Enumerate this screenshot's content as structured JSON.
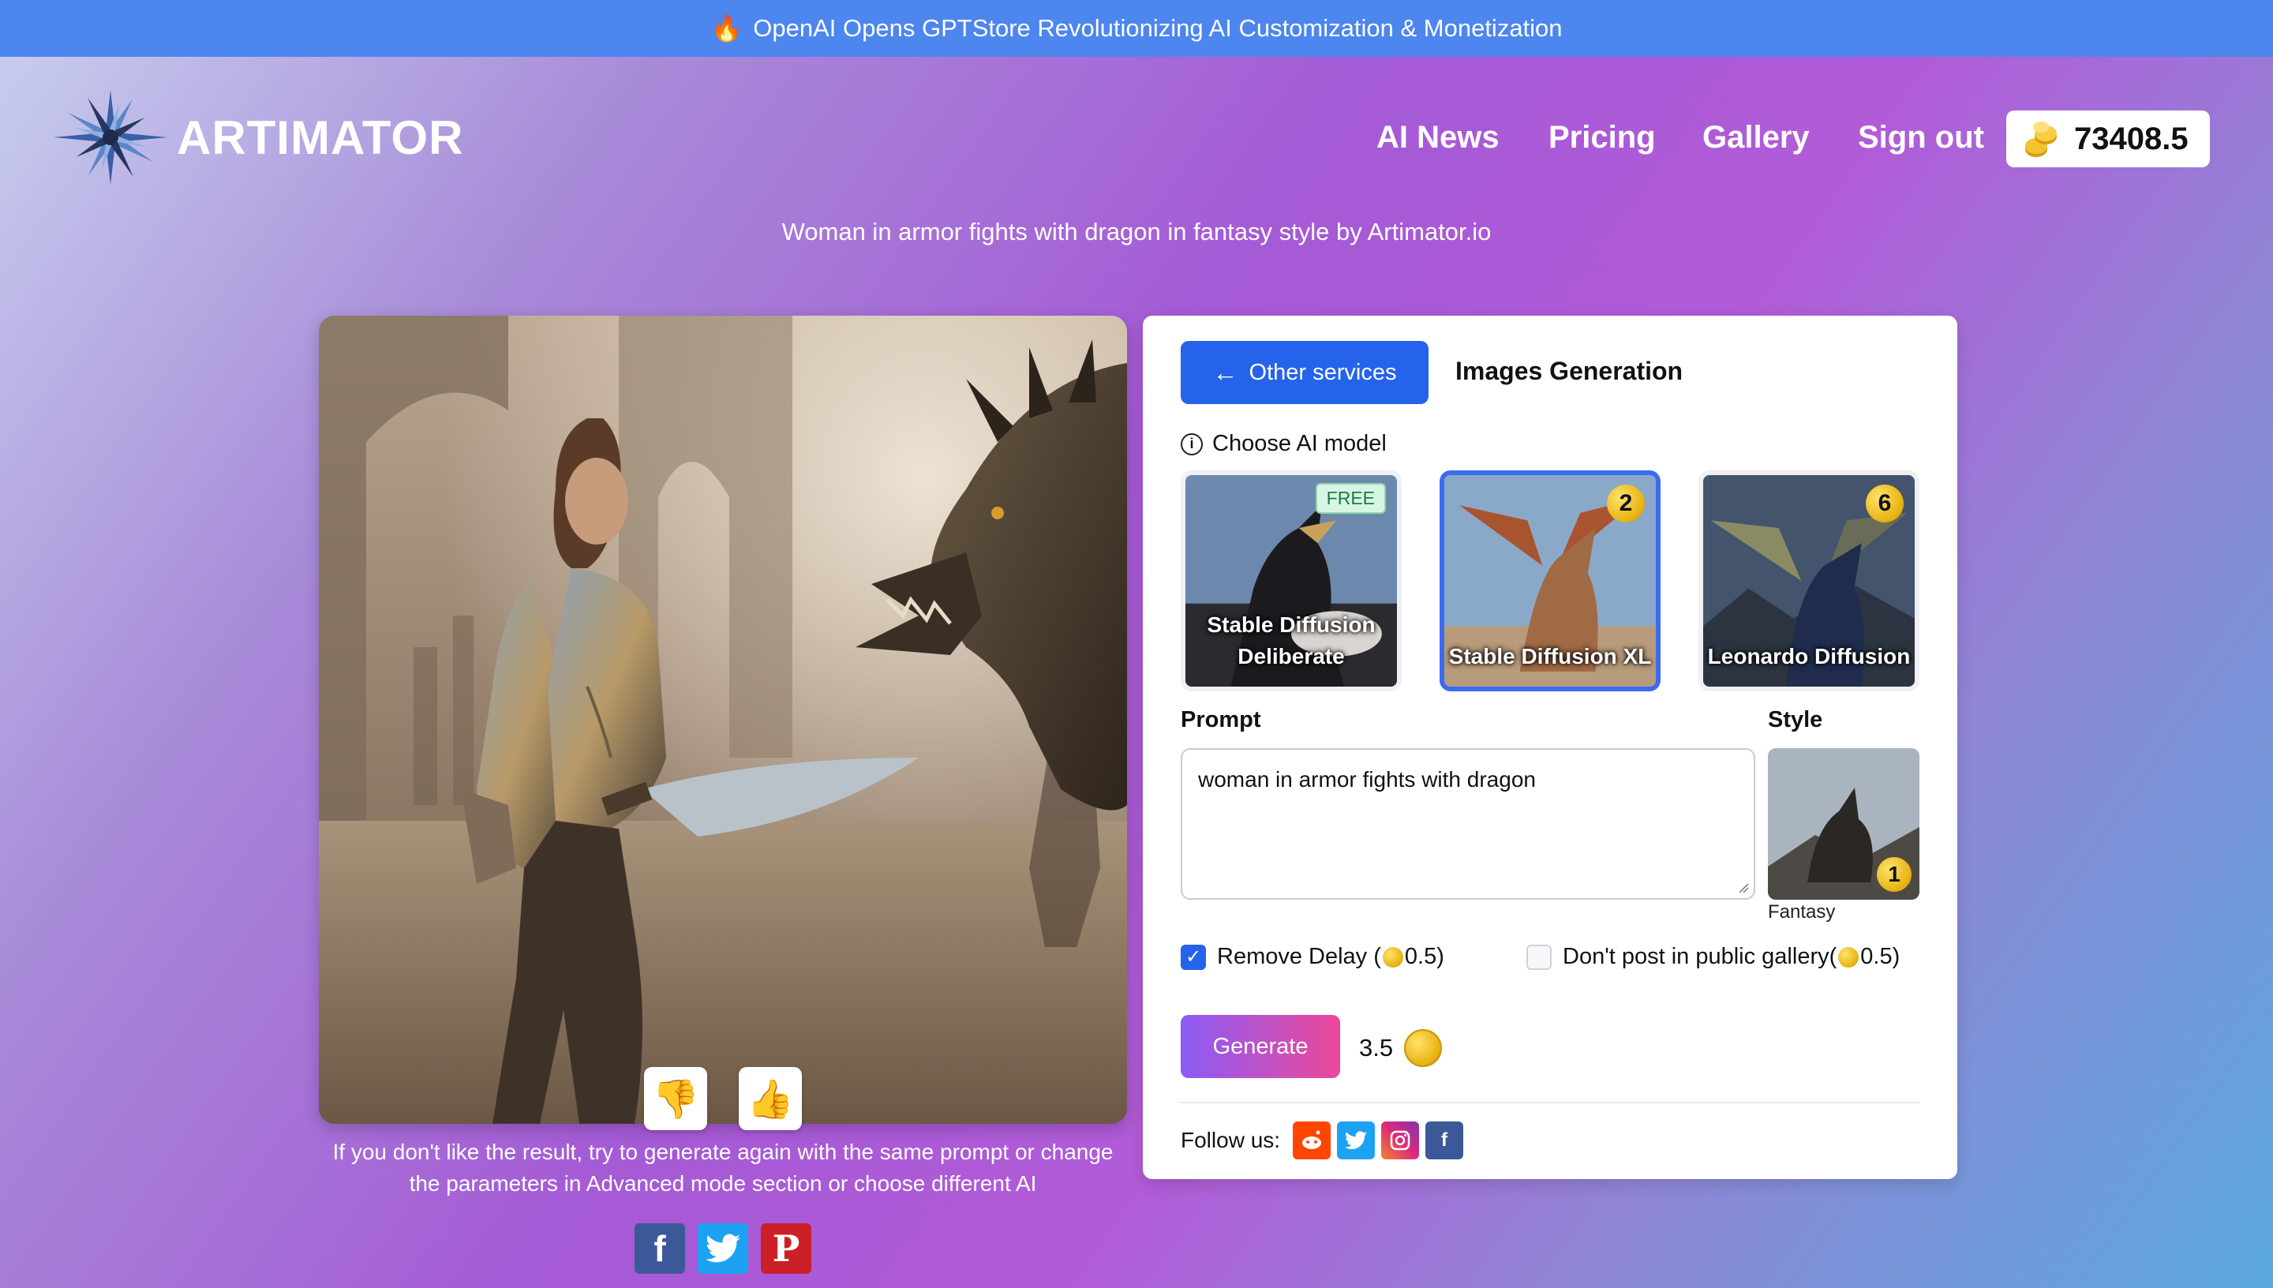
{
  "announcement": {
    "icon": "fire-icon",
    "text": "OpenAI Opens GPTStore Revolutionizing AI Customization & Monetization"
  },
  "header": {
    "logo_text": "ARTIMATOR",
    "nav": [
      "AI News",
      "Pricing",
      "Gallery",
      "Sign out"
    ],
    "balance": "73408.5"
  },
  "subtitle": "Woman in armor fights with dragon in fantasy style by Artimator.io",
  "result": {
    "hint": "If you don't like the result, try to generate again with the same prompt or change the parameters in Advanced mode section or choose different AI",
    "dislike_icon": "thumbs-down-icon",
    "like_icon": "thumbs-up-icon",
    "share": [
      "facebook-icon",
      "twitter-icon",
      "pinterest-icon"
    ]
  },
  "form": {
    "back_button": "Other services",
    "title": "Images Generation",
    "choose_model_label": "Choose AI model",
    "models": [
      {
        "name": "Stable Diffusion Deliberate",
        "badge": "FREE",
        "selected": false
      },
      {
        "name": "Stable Diffusion XL",
        "badge": "2",
        "selected": true
      },
      {
        "name": "Leonardo Diffusion",
        "badge": "6",
        "selected": false
      }
    ],
    "prompt_label": "Prompt",
    "prompt_value": "woman in armor fights with dragon",
    "style_label": "Style",
    "style": {
      "name": "Fantasy",
      "badge": "1"
    },
    "remove_delay_label_pre": "Remove Delay (",
    "remove_delay_label_post": "0.5)",
    "remove_delay_checked": true,
    "no_public_label_pre": "Don't post in public gallery(",
    "no_public_label_post": "0.5)",
    "no_public_checked": false,
    "generate_button": "Generate",
    "cost": "3.5",
    "follow_label": "Follow us:",
    "follow_icons": [
      "reddit-icon",
      "twitter-icon",
      "instagram-icon",
      "facebook-icon"
    ]
  },
  "colors": {
    "primary": "#2563eb",
    "announce_bg": "#4c86ee",
    "generate_gradient": [
      "#8b5cf6",
      "#ec4899"
    ]
  }
}
